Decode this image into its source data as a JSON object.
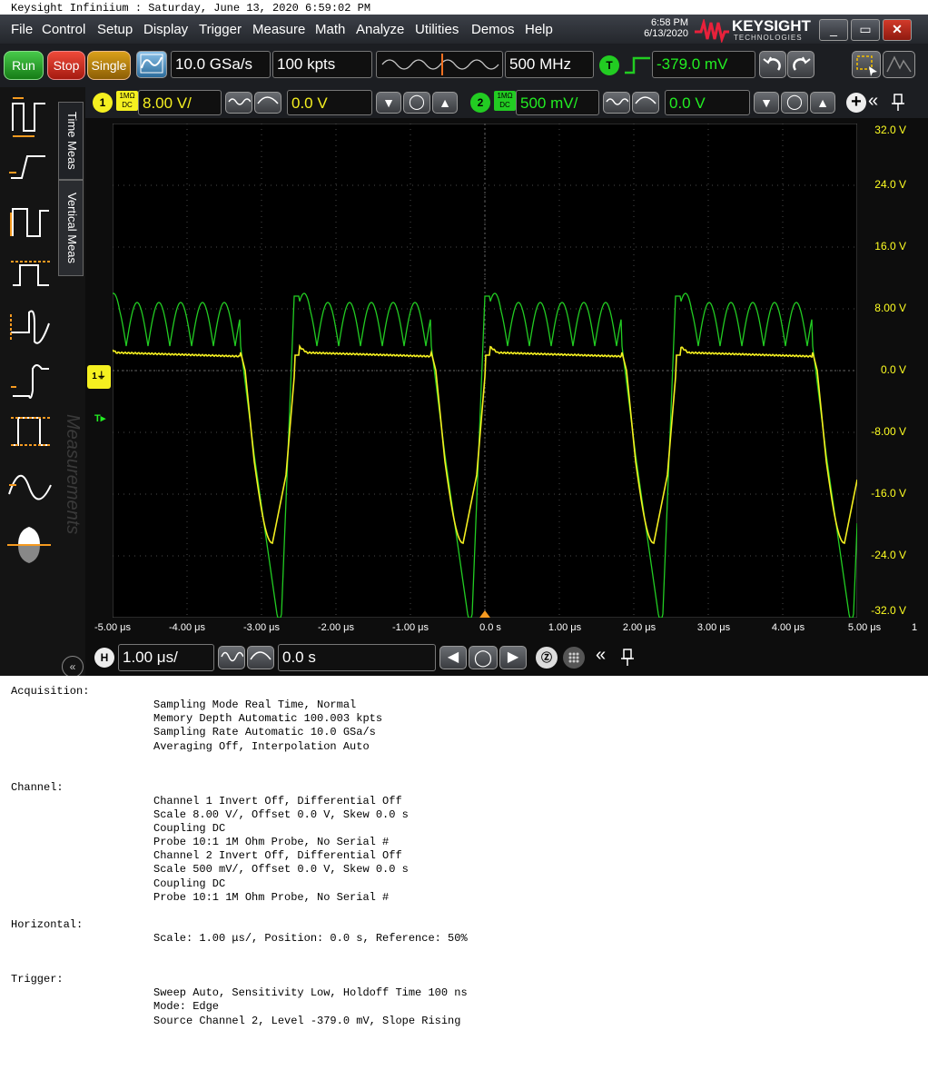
{
  "report_header": "Keysight Infiniium : Saturday, June 13, 2020 6:59:02 PM",
  "menu": [
    "File",
    "Control",
    "Setup",
    "Display",
    "Trigger",
    "Measure",
    "Math",
    "Analyze",
    "Utilities",
    "Demos",
    "Help"
  ],
  "clock": {
    "time": "6:58 PM",
    "date": "6/13/2020"
  },
  "brand": {
    "name": "KEYSIGHT",
    "sub": "TECHNOLOGIES"
  },
  "window_buttons": [
    "_",
    "▭",
    "✕"
  ],
  "toolbar": {
    "run": "Run",
    "stop": "Stop",
    "single": "Single",
    "sample_rate": "10.0 GSa/s",
    "memory_depth": "100 kpts",
    "bandwidth": "500 MHz",
    "trigger_badge": "T",
    "trigger_level": "-379.0 mV"
  },
  "side_tabs": {
    "time_meas": "Time Meas",
    "vertical_meas": "Vertical Meas",
    "measurements": "Measurements"
  },
  "ch1": {
    "num": "1",
    "impedance": "1MΩ",
    "coupling": "DC",
    "scale": "8.00 V/",
    "offset": "0.0 V",
    "color": "#f5f020"
  },
  "ch2": {
    "num": "2",
    "impedance": "1MΩ",
    "coupling": "DC",
    "scale": "500 mV/",
    "offset": "0.0 V",
    "color": "#22cc22"
  },
  "y_axis": [
    "32.0 V",
    "24.0 V",
    "16.0 V",
    "8.00 V",
    "0.0 V",
    "-8.00 V",
    "-16.0 V",
    "-24.0 V",
    "-32.0 V"
  ],
  "x_axis": [
    "-5.00 μs",
    "-4.00 μs",
    "-3.00 μs",
    "-2.00 μs",
    "-1.00 μs",
    "0.0 s",
    "1.00 μs",
    "2.00 μs",
    "3.00 μs",
    "4.00 μs",
    "5.00 μs"
  ],
  "ch1_marker": "1",
  "trigger_marker": "T",
  "corner_label": "1",
  "horizontal": {
    "badge": "H",
    "scale": "1.00 μs/",
    "position": "0.0 s"
  },
  "report": {
    "acquisition_title": "Acquisition:",
    "acquisition": [
      "Sampling Mode Real Time, Normal",
      "Memory Depth Automatic 100.003 kpts",
      "Sampling Rate Automatic 10.0 GSa/s",
      "Averaging Off, Interpolation Auto"
    ],
    "channel_title": "Channel:",
    "channel": [
      "Channel 1 Invert Off, Differential Off",
      "Scale 8.00 V/, Offset 0.0 V, Skew 0.0 s",
      "Coupling DC",
      "Probe 10:1 1M Ohm Probe, No Serial #",
      "Channel 2 Invert Off, Differential Off",
      "Scale 500 mV/, Offset 0.0 V, Skew 0.0 s",
      "Coupling DC",
      "Probe 10:1 1M Ohm Probe, No Serial #"
    ],
    "horizontal_title": "Horizontal:",
    "horizontal": [
      "Scale: 1.00 μs/, Position: 0.0 s, Reference: 50%"
    ],
    "trigger_title": "Trigger:",
    "trigger": [
      "Sweep Auto, Sensitivity Low, Holdoff Time 100 ns",
      "Mode: Edge",
      "Source Channel 2, Level -379.0 mV, Slope Rising"
    ]
  }
}
